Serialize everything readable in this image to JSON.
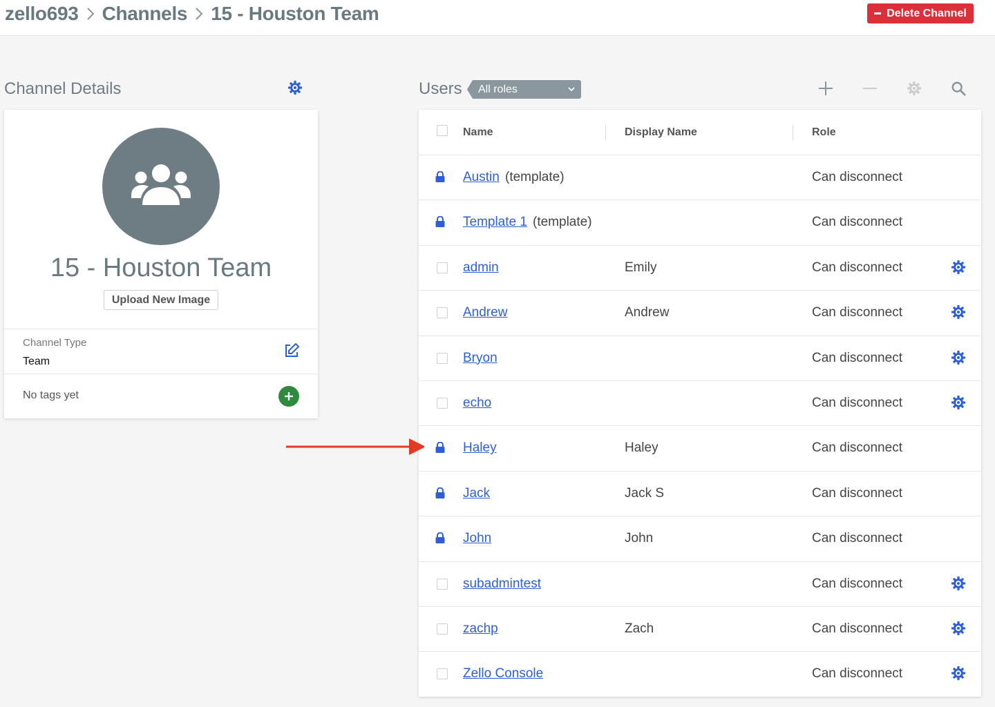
{
  "header": {
    "breadcrumb": [
      "zello693",
      "Channels",
      "15 - Houston Team"
    ],
    "delete_label": "Delete Channel"
  },
  "details": {
    "title": "Channel Details",
    "channel_name": "15 - Houston Team",
    "upload_label": "Upload New Image",
    "type_label": "Channel Type",
    "type_value": "Team",
    "tags_text": "No tags yet"
  },
  "users": {
    "title": "Users",
    "role_filter": "All roles",
    "columns": [
      "Name",
      "Display Name",
      "Role"
    ],
    "rows": [
      {
        "name": "Austin",
        "suffix": "(template)",
        "display": "",
        "role": "Can disconnect",
        "locked": true
      },
      {
        "name": "Template 1",
        "suffix": "(template)",
        "display": "",
        "role": "Can disconnect",
        "locked": true
      },
      {
        "name": "admin",
        "suffix": "",
        "display": "Emily",
        "role": "Can disconnect",
        "locked": false
      },
      {
        "name": "Andrew",
        "suffix": "",
        "display": "Andrew",
        "role": "Can disconnect",
        "locked": false
      },
      {
        "name": "Bryon",
        "suffix": "",
        "display": "",
        "role": "Can disconnect",
        "locked": false
      },
      {
        "name": "echo",
        "suffix": "",
        "display": "",
        "role": "Can disconnect",
        "locked": false
      },
      {
        "name": "Haley",
        "suffix": "",
        "display": "Haley",
        "role": "Can disconnect",
        "locked": true
      },
      {
        "name": "Jack",
        "suffix": "",
        "display": "Jack S",
        "role": "Can disconnect",
        "locked": true
      },
      {
        "name": "John",
        "suffix": "",
        "display": "John",
        "role": "Can disconnect",
        "locked": true
      },
      {
        "name": "subadmintest",
        "suffix": "",
        "display": "",
        "role": "Can disconnect",
        "locked": false
      },
      {
        "name": "zachp",
        "suffix": "",
        "display": "Zach",
        "role": "Can disconnect",
        "locked": false
      },
      {
        "name": "Zello Console",
        "suffix": "",
        "display": "",
        "role": "Can disconnect",
        "locked": false
      }
    ]
  },
  "colors": {
    "accent": "#2f5fd6",
    "danger": "#d9303a",
    "success": "#2e8b3e",
    "annotation_arrow": "#e23b24"
  },
  "icons": {
    "breadcrumb_separator": "chevron-right-icon",
    "settings": "gear-icon",
    "add": "plus-icon",
    "remove": "minus-icon",
    "search": "search-icon",
    "locked": "lock-icon",
    "edit": "edit-icon",
    "avatar": "users-group-icon"
  }
}
